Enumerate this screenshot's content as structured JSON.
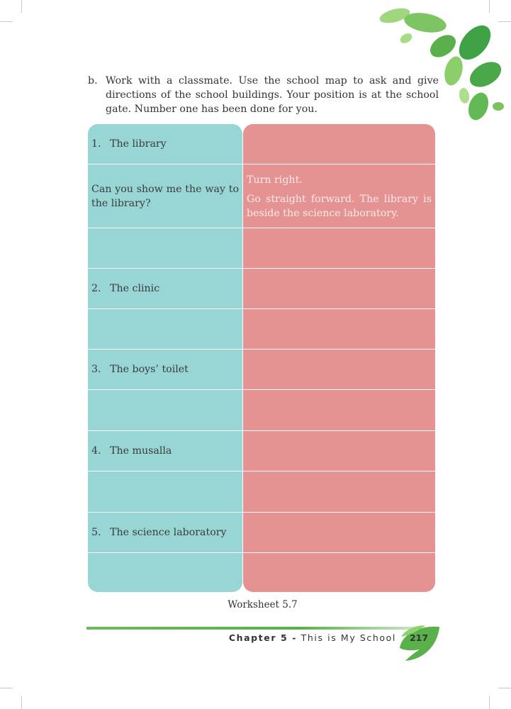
{
  "instruction": {
    "marker": "b.",
    "text": "Work with a classmate. Use the school map to ask and give directions of the school buildings. Your position is at the school gate. Number one has been done for you."
  },
  "worksheet": {
    "rows": [
      {
        "left_num": "1.",
        "left": "The library",
        "right": ""
      },
      {
        "left_num": "",
        "left": "Can you show me the way to the library?",
        "right_lines": [
          "Turn right.",
          "Go straight forward. The library is beside the science laboratory."
        ]
      },
      {
        "left_num": "",
        "left": "",
        "right": ""
      },
      {
        "left_num": "2.",
        "left": "The clinic",
        "right": ""
      },
      {
        "left_num": "",
        "left": "",
        "right": ""
      },
      {
        "left_num": "3.",
        "left": "The boys’ toilet",
        "right": ""
      },
      {
        "left_num": "",
        "left": "",
        "right": ""
      },
      {
        "left_num": "4.",
        "left": "The musalla",
        "right": ""
      },
      {
        "left_num": "",
        "left": "",
        "right": ""
      },
      {
        "left_num": "5.",
        "left": "The science laboratory",
        "right": ""
      },
      {
        "left_num": "",
        "left": "",
        "right": ""
      }
    ]
  },
  "caption": "Worksheet 5.7",
  "footer": {
    "chapter_label": "Chapter 5 -",
    "chapter_title": "This is My School",
    "page_number": "217"
  },
  "colors": {
    "left_column": "#98d5d5",
    "right_column": "#e59293",
    "footer_line": "#5ab04a",
    "leaf_green": "#5ab04a"
  }
}
